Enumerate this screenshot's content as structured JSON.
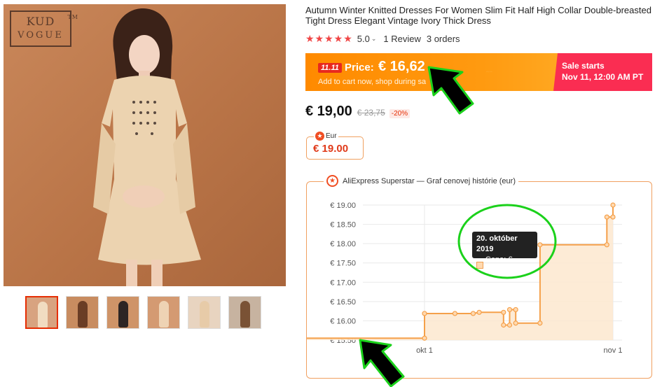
{
  "product": {
    "title": "Autumn Winter Knitted Dresses For Women Slim Fit Half High Collar Double-breasted Tight Dress Elegant Vintage Ivory Thick Dress",
    "rating": "5.0",
    "rating_chevron": "⌄",
    "stars": "★★★★★",
    "reviews": "1 Review",
    "orders": "3 orders"
  },
  "brand": {
    "line1": "KUD",
    "line2": "VOGUE",
    "tm": "TM"
  },
  "promo": {
    "badge": "11.11",
    "label": "Price:",
    "price": "€ 16,62",
    "sub": "Add to cart now, shop during sa",
    "sale_line1": "Sale starts",
    "sale_line2": "Nov 11, 12:00 AM PT"
  },
  "price": {
    "current": "€ 19,00",
    "original": "€ 23,75",
    "discount": "-20%"
  },
  "eur_widget": {
    "label": "Eur",
    "value": "€ 19.00"
  },
  "history": {
    "header": "AliExpress Superstar — Graf cenovej histórie (eur)",
    "tooltip_date": "20. október 2019",
    "tooltip_value": "Cena: € 17.97"
  },
  "thumbnails": [
    {
      "name": "beige",
      "bg": "#d8a380",
      "fig": "#f1dcc1"
    },
    {
      "name": "brown",
      "bg": "#c88c60",
      "fig": "#6a3d25"
    },
    {
      "name": "black",
      "bg": "#cf9468",
      "fig": "#2d2524"
    },
    {
      "name": "beige-detail",
      "bg": "#d49a72",
      "fig": "#eed3b4"
    },
    {
      "name": "beige-closeup",
      "bg": "#e8d4c0",
      "fig": "#e7cba8"
    },
    {
      "name": "coffee",
      "bg": "#c7b3a0",
      "fig": "#7a5235"
    }
  ],
  "colors": {
    "accent_orange": "#ff8a00",
    "sale_red": "#fa2d52",
    "price_red": "#e03a1a",
    "chart_line": "#f5a04a",
    "annotation_green": "#1bd11b"
  },
  "chart_data": {
    "type": "area",
    "title": "",
    "xlabel": "",
    "ylabel": "",
    "x_ticks": [
      "okt 1",
      "nov 1"
    ],
    "y_ticks": [
      "€ 15.50",
      "€ 16.00",
      "€ 16.50",
      "€ 17.00",
      "€ 17.50",
      "€ 18.00",
      "€ 18.50",
      "€ 19.00"
    ],
    "ylim": [
      15.5,
      19.0
    ],
    "grid": true,
    "series": [
      {
        "x": [
          "2019-09-05",
          "2019-10-01",
          "2019-10-01",
          "2019-10-06",
          "2019-10-09",
          "2019-10-10",
          "2019-10-14",
          "2019-10-14",
          "2019-10-15",
          "2019-10-15",
          "2019-10-16",
          "2019-10-16",
          "2019-10-20",
          "2019-10-20",
          "2019-10-31",
          "2019-10-31",
          "2019-11-01",
          "2019-11-01"
        ],
        "y": [
          15.55,
          15.55,
          16.19,
          16.19,
          16.19,
          16.22,
          16.22,
          15.89,
          15.89,
          16.29,
          16.29,
          15.94,
          15.94,
          17.97,
          17.97,
          18.69,
          18.69,
          19.0
        ]
      }
    ]
  }
}
